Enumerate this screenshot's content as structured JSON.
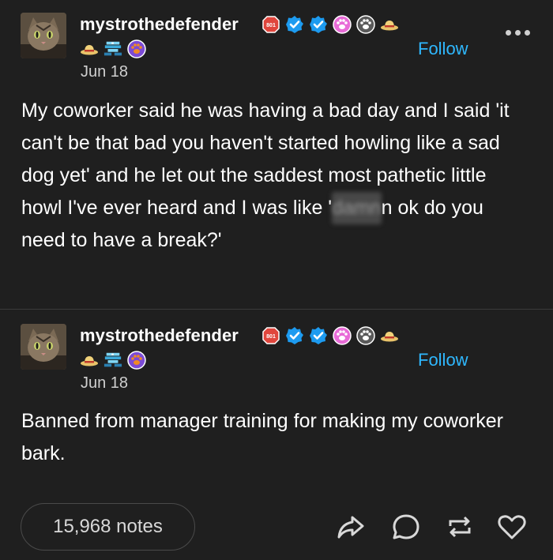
{
  "posts": [
    {
      "username": "mystrothedefender",
      "date": "Jun 18",
      "follow_label": "Follow",
      "badge_counter": "801",
      "body_before": "My coworker said he was having a bad day and I said 'it can't be that bad you haven't started howling like a sad dog yet' and he let out the saddest most pathetic little howl I've ever heard and I was like '",
      "body_redacted": "damn",
      "body_after": "n ok do you need to have a break?'"
    },
    {
      "username": "mystrothedefender",
      "date": "Jun 18",
      "follow_label": "Follow",
      "badge_counter": "801",
      "body": "Banned from manager training for making my coworker bark."
    }
  ],
  "footer": {
    "notes_label": "15,968 notes",
    "actions": [
      "share-icon",
      "reply-icon",
      "reblog-icon",
      "like-icon"
    ]
  },
  "colors": {
    "background": "#1f1f1f",
    "accent": "#2fb8ff",
    "verified": "#1d9bf0",
    "counter_badge": "#e0463d",
    "paw_badge": "#e86bd7",
    "purple_badge": "#7b4bd6"
  }
}
